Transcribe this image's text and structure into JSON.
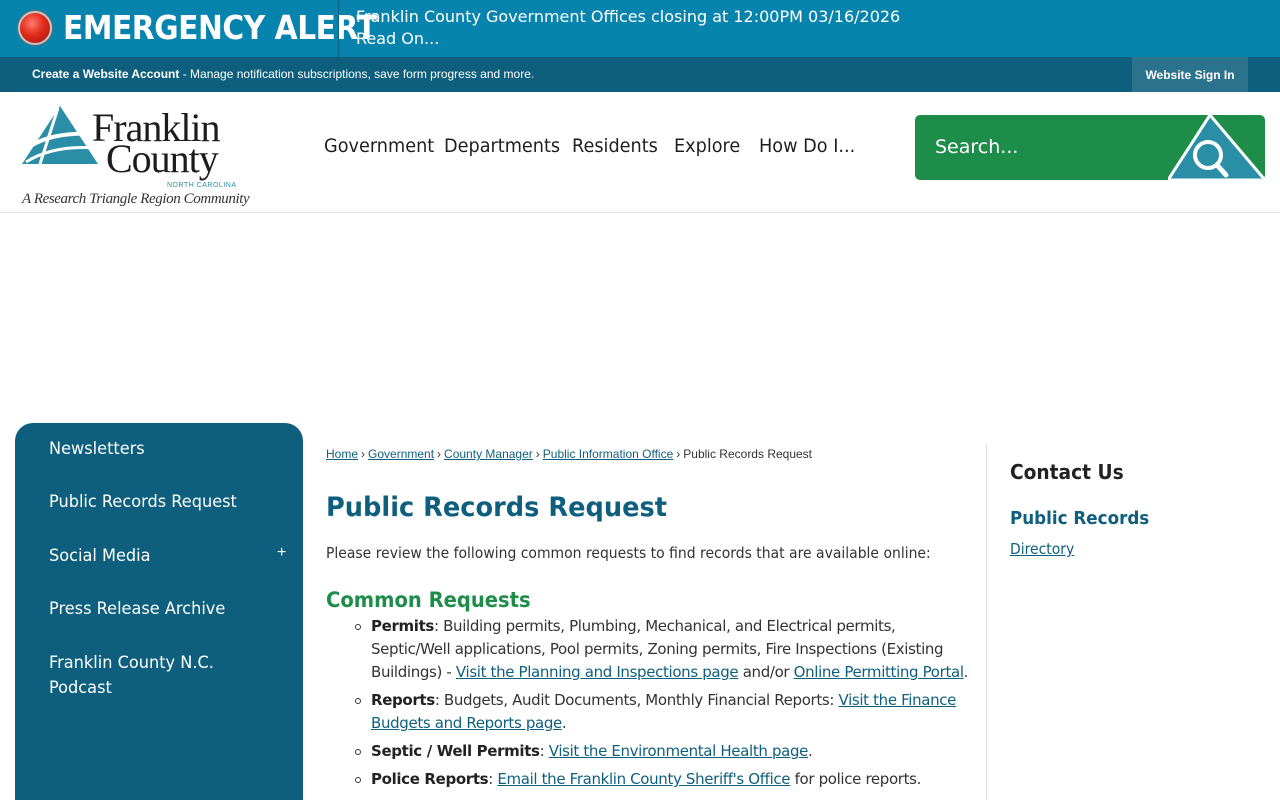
{
  "alert": {
    "title": "EMERGENCY ALERT",
    "message_line1": "Franklin County Government Offices closing at 12:00PM 03/16/2026",
    "message_line2": "Read On...",
    "dot_color": "#e32b1b"
  },
  "account_bar": {
    "create_label": "Create a Website Account",
    "create_desc": " - Manage notification subscriptions, save form progress and more.",
    "signin_label": "Website Sign In"
  },
  "logo": {
    "name_line1": "Franklin",
    "name_line2": "County",
    "state": "NORTH CAROLINA",
    "tagline": "A Research Triangle Region Community"
  },
  "nav": {
    "items": [
      "Government",
      "Departments",
      "Residents",
      "Explore",
      "How Do I..."
    ]
  },
  "search": {
    "placeholder": "Search...",
    "icon": "search-icon"
  },
  "sidebar": {
    "items": [
      {
        "label": "Newsletters"
      },
      {
        "label": "Public Records Request"
      },
      {
        "label": "Social Media",
        "expand": "+"
      },
      {
        "label": "Press Release Archive"
      },
      {
        "label_line1": "Franklin County N.C.",
        "label_line2": "Podcast"
      }
    ]
  },
  "breadcrumb": {
    "items": [
      "Home",
      "Government",
      "County Manager",
      "Public Information Office"
    ],
    "current": "Public Records Request",
    "separator": "›"
  },
  "main": {
    "title": "Public Records Request",
    "intro": "Please review the following common requests to find records that are available online:",
    "common_heading": "Common Requests",
    "requests": [
      {
        "label": "Permits",
        "text": ": Building permits, Plumbing, Mechanical, and Electrical permits, Septic/Well applications, Pool permits, Zoning permits, Fire Inspections (Existing Buildings) - ",
        "link1": "Visit the Planning and Inspections page",
        "middle": " and/or ",
        "link2": "Online Permitting Portal",
        "end": "."
      },
      {
        "label": "Reports",
        "text": ": Budgets, Audit Documents, Monthly Financial Reports: ",
        "link1": "Visit the Finance Budgets and Reports page",
        "end": "."
      },
      {
        "label": "Septic / Well Permits",
        "text": ": ",
        "link1": "Visit the Environmental Health page",
        "end": "."
      },
      {
        "label": "Police Reports",
        "text": ": ",
        "link1": "Email the Franklin County Sheriff's Office",
        "end": " for police reports."
      }
    ]
  },
  "contact": {
    "title": "Contact Us",
    "subtitle": "Public Records",
    "link": "Directory"
  },
  "colors": {
    "alert_bg": "#0784ae",
    "account_bg": "#0e5f7d",
    "brand_teal": "#0e5f7d",
    "brand_green": "#1f8d4a"
  }
}
